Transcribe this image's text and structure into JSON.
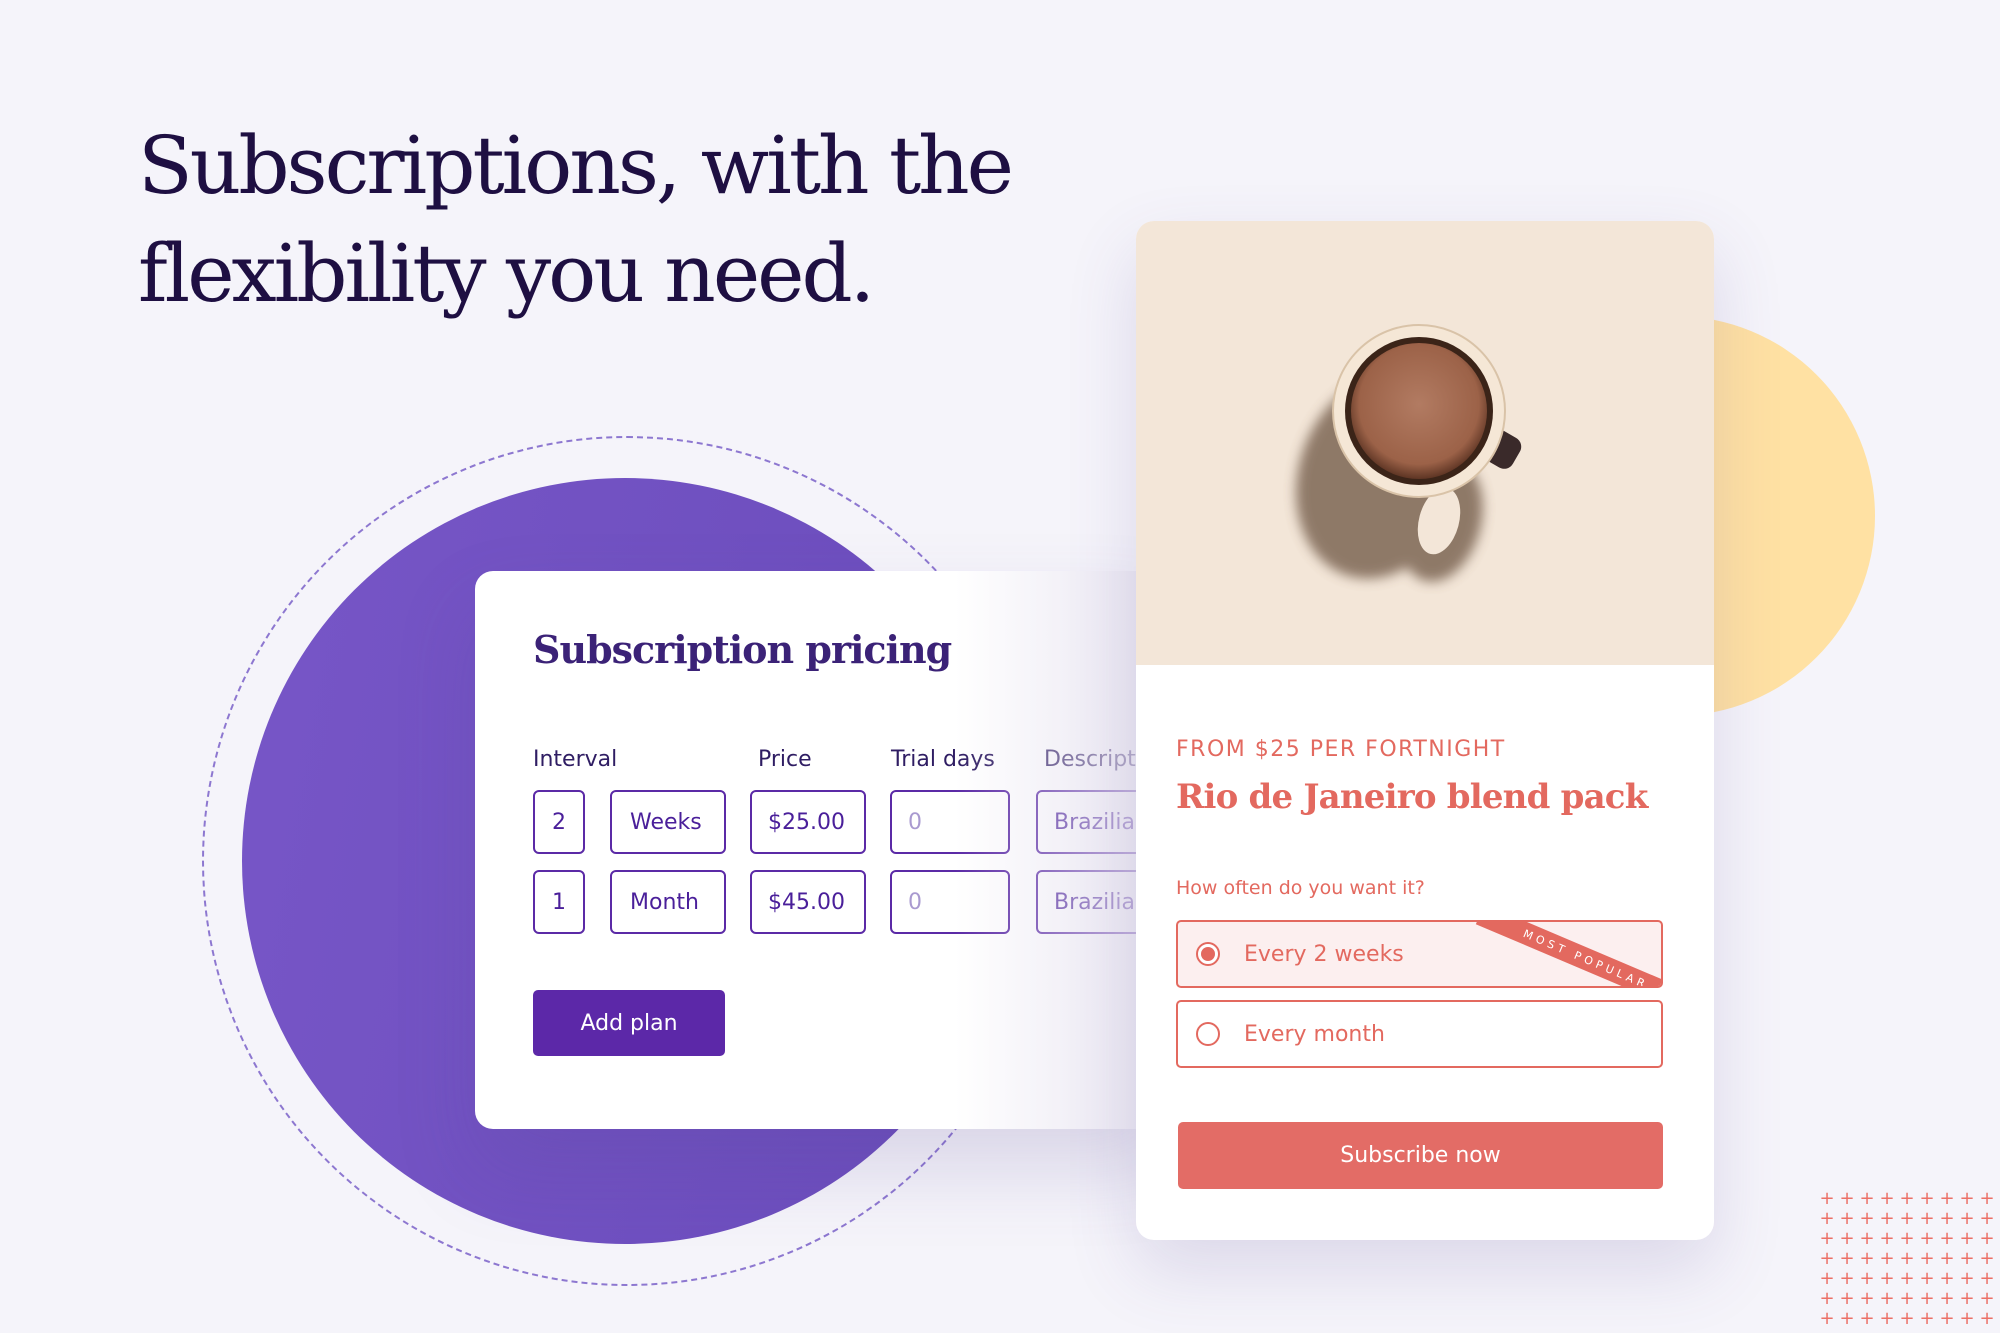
{
  "headline": {
    "line1": "Subscriptions, with the",
    "line2": "flexibility you need."
  },
  "pricing": {
    "title": "Subscription pricing",
    "columns": [
      "Interval",
      "Price",
      "Trial days",
      "Descript"
    ],
    "rows": [
      {
        "interval_count": "2",
        "interval_unit": "Weeks",
        "price": "$25.00",
        "trial_days_placeholder": "0",
        "description": "Brazilian"
      },
      {
        "interval_count": "1",
        "interval_unit": "Month",
        "price": "$45.00",
        "trial_days_placeholder": "0",
        "description": "Brazilian"
      }
    ],
    "add_plan_label": "Add plan"
  },
  "product": {
    "image_icon": "coffee-mug-photo",
    "eyebrow": "FROM $25 PER FORTNIGHT",
    "title": "Rio de Janeiro blend pack",
    "frequency_question": "How often do you want it?",
    "options": [
      {
        "label": "Every 2 weeks",
        "selected": true,
        "badge": "MOST POPULAR"
      },
      {
        "label": "Every month",
        "selected": false
      }
    ],
    "subscribe_label": "Subscribe now"
  },
  "colors": {
    "headline": "#1e0f42",
    "purple_accent": "#5c28a8",
    "coral_accent": "#e3695f",
    "yellow_accent": "#ffe1a3",
    "background": "#f5f4fa"
  },
  "decoration": {
    "plus_grid_icon": "plus-pattern"
  }
}
